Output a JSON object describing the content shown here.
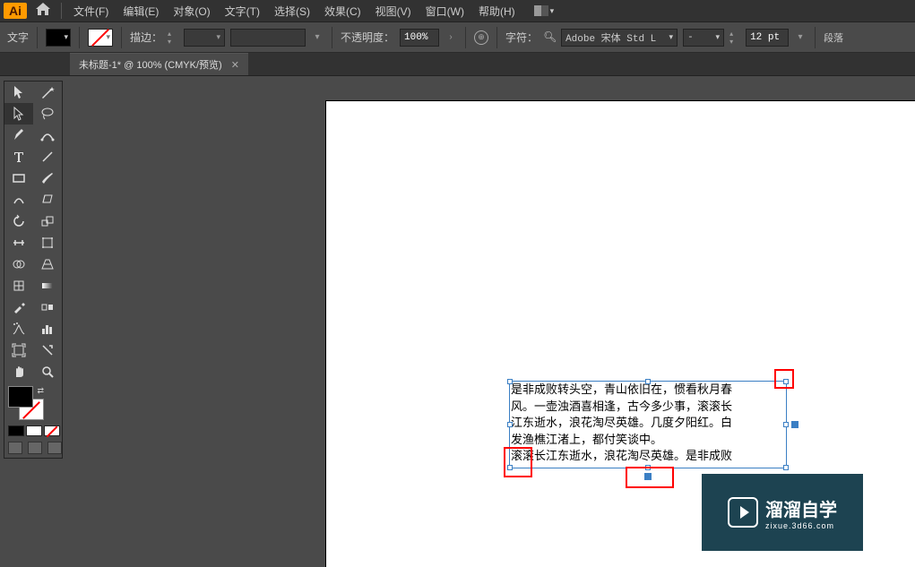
{
  "menubar": {
    "app": "Ai",
    "items": [
      "文件(F)",
      "编辑(E)",
      "对象(O)",
      "文字(T)",
      "选择(S)",
      "效果(C)",
      "视图(V)",
      "窗口(W)",
      "帮助(H)"
    ]
  },
  "controlbar": {
    "mode": "文字",
    "stroke_label": "描边：",
    "opacity_label": "不透明度：",
    "opacity_value": "100%",
    "char_label": "字符：",
    "font_name": "Adobe 宋体 Std L",
    "font_style": "-",
    "font_size": "12 pt",
    "para_label": "段落"
  },
  "tabs": {
    "doc1": "未标题-1* @ 100% (CMYK/预览)"
  },
  "canvas": {
    "text": "是非成败转头空，青山依旧在，惯看秋月春\n风。一壶浊酒喜相逢，古今多少事，滚滚长\n江东逝水，浪花淘尽英雄。几度夕阳红。白\n发渔樵江渚上，都付笑谈中。\n滚滚长江东逝水，浪花淘尽英雄。是非成败"
  },
  "watermark": {
    "main": "溜溜自学",
    "sub": "zixue.3d66.com"
  }
}
